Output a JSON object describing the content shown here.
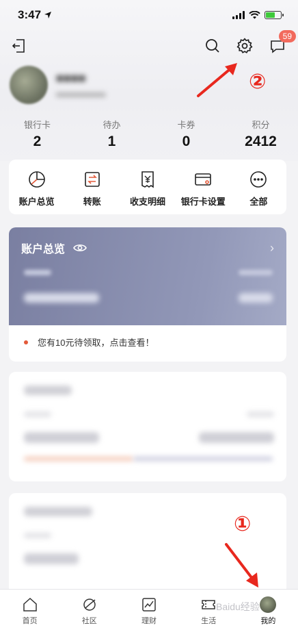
{
  "status_bar": {
    "time": "3:47",
    "icons": [
      "location-arrow-icon",
      "signal-icon",
      "wifi-icon",
      "battery-icon"
    ]
  },
  "header": {
    "icons": [
      "exit-icon",
      "search-icon",
      "gear-icon",
      "message-icon"
    ],
    "message_badge": "59"
  },
  "annotations": {
    "circle_1": "①",
    "circle_2": "②",
    "color": "#e8281e"
  },
  "stats": [
    {
      "label": "银行卡",
      "value": "2"
    },
    {
      "label": "待办",
      "value": "1"
    },
    {
      "label": "卡券",
      "value": "0"
    },
    {
      "label": "积分",
      "value": "2412"
    }
  ],
  "quick_actions": [
    {
      "label": "账户总览",
      "icon": "pie-chart-icon"
    },
    {
      "label": "转账",
      "icon": "transfer-icon"
    },
    {
      "label": "收支明细",
      "icon": "receipt-icon"
    },
    {
      "label": "银行卡设置",
      "icon": "card-settings-icon"
    },
    {
      "label": "全部",
      "icon": "more-icon"
    }
  ],
  "overview": {
    "title": "账户总览",
    "eye_icon": "eye-icon",
    "notice": "您有10元待领取，点击查看！"
  },
  "tabbar": {
    "items": [
      {
        "label": "首页",
        "icon": "home-icon"
      },
      {
        "label": "社区",
        "icon": "community-icon"
      },
      {
        "label": "理财",
        "icon": "chart-icon"
      },
      {
        "label": "生活",
        "icon": "ticket-icon"
      },
      {
        "label": "我的",
        "icon": "avatar"
      }
    ]
  },
  "watermark": "Baidu经验",
  "colors": {
    "accent": "#e8281e",
    "card_gradient_start": "#7a7fa1",
    "badge": "#f26a5d"
  }
}
